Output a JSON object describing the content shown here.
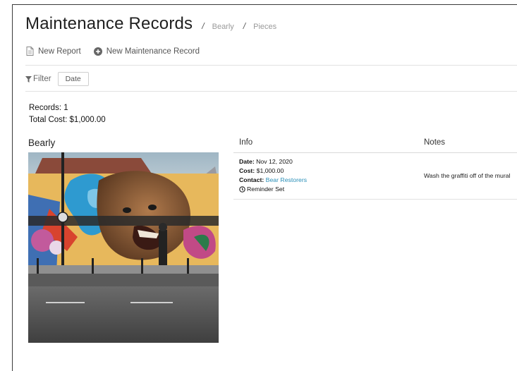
{
  "header": {
    "title": "Maintenance Records",
    "breadcrumb": [
      "Bearly",
      "Pieces"
    ],
    "separator": "/"
  },
  "actions": {
    "new_report": {
      "label": "New Report",
      "icon": "document-icon"
    },
    "new_record": {
      "label": "New Maintenance Record",
      "icon": "plus-circle-icon"
    }
  },
  "filter": {
    "label": "Filter",
    "icon": "funnel-icon",
    "date_button": "Date"
  },
  "summary": {
    "records": "Records: 1",
    "total_cost": "Total Cost: $1,000.00"
  },
  "piece": {
    "name": "Bearly"
  },
  "table": {
    "headers": {
      "info": "Info",
      "notes": "Notes"
    },
    "rows": [
      {
        "date_label": "Date:",
        "date_value": "Nov 12, 2020",
        "cost_label": "Cost:",
        "cost_value": "$1,000.00",
        "contact_label": "Contact:",
        "contact_value": "Bear Restorers",
        "reminder": "Reminder Set",
        "notes": "Wash the graffiti off of the mural"
      }
    ]
  },
  "colors": {
    "link": "#2a8fb8",
    "divider": "#e2e2e2",
    "text": "#222222"
  }
}
